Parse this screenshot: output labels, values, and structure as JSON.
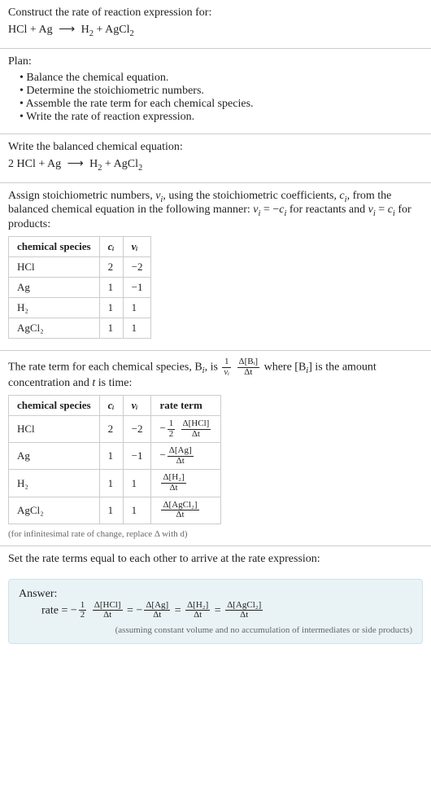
{
  "intro": {
    "heading": "Construct the rate of reaction expression for:",
    "equation_lhs": "HCl + Ag",
    "arrow": "⟶",
    "equation_rhs_h2": "H",
    "equation_rhs_h2_sub": "2",
    "equation_rhs_plus": " + AgCl",
    "equation_rhs_agcl_sub": "2"
  },
  "plan": {
    "title": "Plan:",
    "items": [
      "Balance the chemical equation.",
      "Determine the stoichiometric numbers.",
      "Assemble the rate term for each chemical species.",
      "Write the rate of reaction expression."
    ]
  },
  "balanced": {
    "heading": "Write the balanced chemical equation:",
    "lhs": "2 HCl + Ag",
    "arrow": "⟶",
    "rhs_h2": "H",
    "rhs_h2_sub": "2",
    "rhs_plus": " + AgCl",
    "rhs_agcl_sub": "2"
  },
  "stoich": {
    "para_a": "Assign stoichiometric numbers, ",
    "nu_i": "ν",
    "nu_i_sub": "i",
    "para_b": ", using the stoichiometric coefficients, ",
    "c_i": "c",
    "c_i_sub": "i",
    "para_c": ", from the balanced chemical equation in the following manner: ",
    "rel1_a": "ν",
    "rel1_asub": "i",
    "rel1_eq": " = −",
    "rel1_b": "c",
    "rel1_bsub": "i",
    "para_d": " for reactants and ",
    "rel2_a": "ν",
    "rel2_asub": "i",
    "rel2_eq": " = ",
    "rel2_b": "c",
    "rel2_bsub": "i",
    "para_e": " for products:",
    "headers": {
      "species": "chemical species",
      "c": "cᵢ",
      "nu": "νᵢ"
    },
    "rows": [
      {
        "species": "HCl",
        "c": "2",
        "nu": "−2"
      },
      {
        "species": "Ag",
        "c": "1",
        "nu": "−1"
      },
      {
        "species": "H₂",
        "c": "1",
        "nu": "1"
      },
      {
        "species": "AgCl₂",
        "c": "1",
        "nu": "1"
      }
    ]
  },
  "rate_term": {
    "para_a": "The rate term for each chemical species, B",
    "para_a_sub": "i",
    "para_b": ", is ",
    "frac1_num": "1",
    "frac1_den": "νᵢ",
    "frac2_num": "Δ[Bᵢ]",
    "frac2_den": "Δt",
    "para_c": " where [B",
    "para_c_sub": "i",
    "para_d": "] is the amount concentration and ",
    "t_var": "t",
    "para_e": " is time:",
    "headers": {
      "species": "chemical species",
      "c": "cᵢ",
      "nu": "νᵢ",
      "rate": "rate term"
    },
    "rows": [
      {
        "species": "HCl",
        "c": "2",
        "nu": "−2",
        "prefix": "−",
        "coef_num": "1",
        "coef_den": "2",
        "d_num": "Δ[HCl]",
        "d_den": "Δt"
      },
      {
        "species": "Ag",
        "c": "1",
        "nu": "−1",
        "prefix": "−",
        "coef_num": "",
        "coef_den": "",
        "d_num": "Δ[Ag]",
        "d_den": "Δt"
      },
      {
        "species": "H₂",
        "c": "1",
        "nu": "1",
        "prefix": "",
        "coef_num": "",
        "coef_den": "",
        "d_num": "Δ[H₂]",
        "d_den": "Δt"
      },
      {
        "species": "AgCl₂",
        "c": "1",
        "nu": "1",
        "prefix": "",
        "coef_num": "",
        "coef_den": "",
        "d_num": "Δ[AgCl₂]",
        "d_den": "Δt"
      }
    ],
    "footnote": "(for infinitesimal rate of change, replace Δ with d)"
  },
  "final": {
    "heading": "Set the rate terms equal to each other to arrive at the rate expression:"
  },
  "answer": {
    "title": "Answer:",
    "rate_label": "rate = ",
    "neg": "−",
    "half_num": "1",
    "half_den": "2",
    "t1_num": "Δ[HCl]",
    "t1_den": "Δt",
    "eq1": " = ",
    "t2_num": "Δ[Ag]",
    "t2_den": "Δt",
    "eq2": " = ",
    "t3_num": "Δ[H₂]",
    "t3_den": "Δt",
    "eq3": " = ",
    "t4_num": "Δ[AgCl₂]",
    "t4_den": "Δt",
    "note": "(assuming constant volume and no accumulation of intermediates or side products)"
  },
  "chart_data": {
    "type": "table",
    "tables": [
      {
        "title": "Stoichiometric numbers",
        "columns": [
          "chemical species",
          "c_i",
          "nu_i"
        ],
        "rows": [
          [
            "HCl",
            2,
            -2
          ],
          [
            "Ag",
            1,
            -1
          ],
          [
            "H2",
            1,
            1
          ],
          [
            "AgCl2",
            1,
            1
          ]
        ]
      },
      {
        "title": "Rate terms",
        "columns": [
          "chemical species",
          "c_i",
          "nu_i",
          "rate term"
        ],
        "rows": [
          [
            "HCl",
            2,
            -2,
            "-(1/2) Δ[HCl]/Δt"
          ],
          [
            "Ag",
            1,
            -1,
            "-Δ[Ag]/Δt"
          ],
          [
            "H2",
            1,
            1,
            "Δ[H2]/Δt"
          ],
          [
            "AgCl2",
            1,
            1,
            "Δ[AgCl2]/Δt"
          ]
        ]
      }
    ]
  }
}
